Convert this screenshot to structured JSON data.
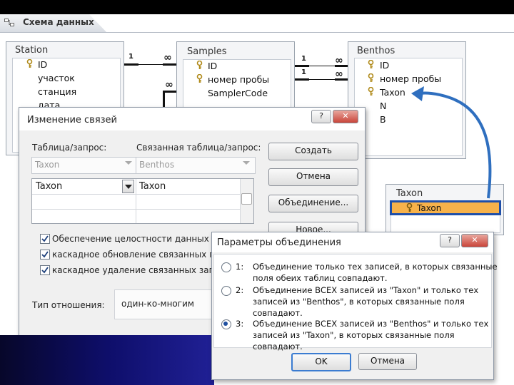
{
  "window": {
    "title": "Схема данных"
  },
  "tables": {
    "station": {
      "title": "Station",
      "fields": [
        "ID",
        "участок",
        "станция",
        "дата"
      ]
    },
    "samples": {
      "title": "Samples",
      "fields": [
        "ID",
        "номер пробы",
        "SamplerCode"
      ]
    },
    "benthos": {
      "title": "Benthos",
      "fields": [
        "ID",
        "номер пробы",
        "Taxon",
        "N",
        "B"
      ]
    },
    "taxon": {
      "title": "Taxon",
      "fields": [
        "Taxon"
      ]
    }
  },
  "relations": {
    "one": "1",
    "many": "∞"
  },
  "edit_dialog": {
    "title": "Изменение связей",
    "help": "?",
    "close": "✕",
    "table_label": "Таблица/запрос:",
    "related_label": "Связанная таблица/запрос:",
    "table_value": "Taxon",
    "related_value": "Benthos",
    "grid_left": "Taxon",
    "grid_right": "Taxon",
    "buttons": {
      "create": "Создать",
      "cancel": "Отмена",
      "join": "Объединение...",
      "new": "Новое..."
    },
    "checks": [
      {
        "label": "Обеспечение целостности данных",
        "checked": true
      },
      {
        "label": "каскадное обновление связанных поле",
        "checked": true
      },
      {
        "label": "каскадное удаление связанных запис",
        "checked": true
      }
    ],
    "relation_type_label": "Тип отношения:",
    "relation_type_value": "один-ко-многим"
  },
  "join_dialog": {
    "title": "Параметры объединения",
    "help": "?",
    "close": "✕",
    "options": [
      {
        "num": "1:",
        "line1": "Объединение только тех записей, в которых связанные",
        "line2": "поля обеих таблиц совпадают.",
        "line3": ""
      },
      {
        "num": "2:",
        "line1": "Объединение ВСЕХ записей из \"Taxon\" и только тех",
        "line2": "записей из \"Benthos\", в которых связанные поля",
        "line3": "совпадают."
      },
      {
        "num": "3:",
        "line1": "Объединение ВСЕХ записей из \"Benthos\" и только тех",
        "line2": "записей из \"Taxon\", в которых связанные поля",
        "line3": "совпадают."
      }
    ],
    "selected_option": 3,
    "ok": "OK",
    "cancel": "Отмена"
  },
  "colors": {
    "highlight": "#f7b24a",
    "arrow": "#2f6fbf",
    "selection_border": "#1f4fa8"
  }
}
